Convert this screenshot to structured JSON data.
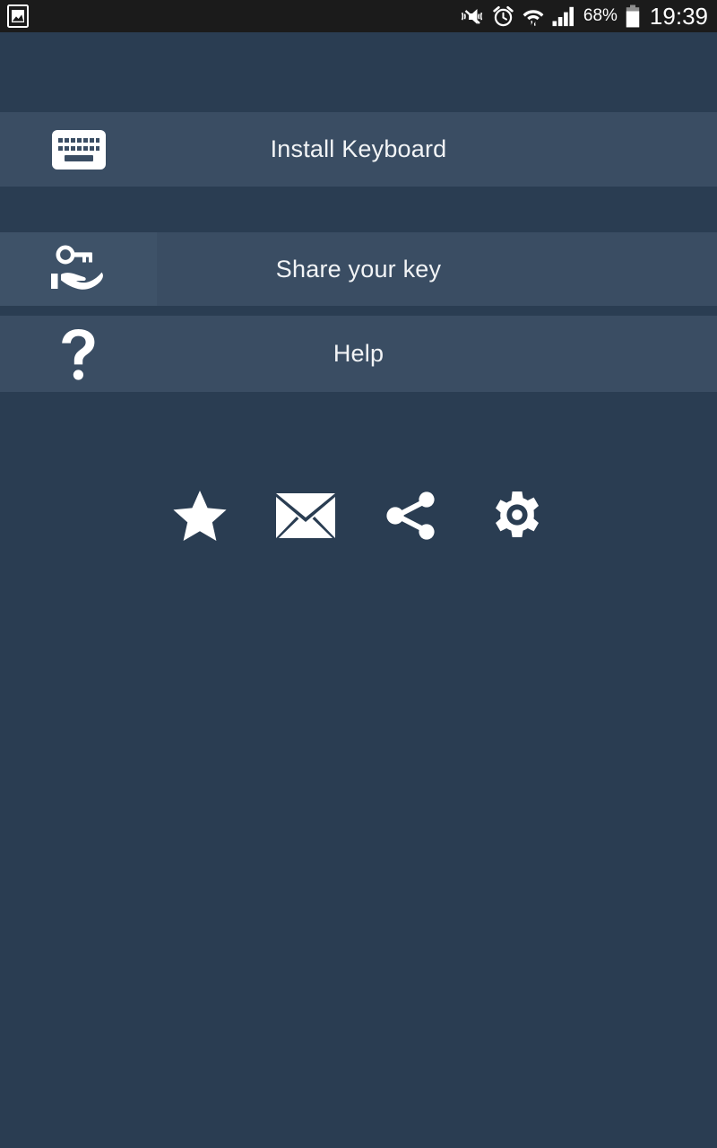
{
  "statusbar": {
    "left_icons": [
      {
        "name": "screenshot-image-icon",
        "glyph": "image"
      }
    ],
    "right_icons": [
      {
        "name": "vibrate-mute-icon",
        "glyph": "mute"
      },
      {
        "name": "alarm-clock-icon",
        "glyph": "alarm"
      },
      {
        "name": "wifi-data-icon",
        "glyph": "wifi"
      },
      {
        "name": "signal-bars-icon",
        "glyph": "signal"
      }
    ],
    "battery_percent": "68%",
    "battery_icon": "battery-icon",
    "clock": "19:39",
    "background": "#1b1b1b",
    "foreground": "#ffffff"
  },
  "theme": {
    "page_background": "#2a3d52",
    "row_background": "#3a4d63",
    "row_icon_tint": "#3e5268",
    "text_color": "#f2f4f6",
    "icon_color": "#ffffff"
  },
  "menu": {
    "rows": [
      {
        "id": "install-keyboard",
        "label": "Install Keyboard",
        "icon": "keyboard-icon",
        "tinted_icon_box": false
      },
      {
        "id": "share-your-key",
        "label": "Share your key",
        "icon": "hand-key-icon",
        "tinted_icon_box": true
      },
      {
        "id": "help",
        "label": "Help",
        "icon": "question-mark-icon",
        "tinted_icon_box": false
      }
    ]
  },
  "iconbar": {
    "buttons": [
      {
        "id": "rate",
        "icon": "star-icon"
      },
      {
        "id": "email",
        "icon": "envelope-icon"
      },
      {
        "id": "share",
        "icon": "share-icon"
      },
      {
        "id": "settings",
        "icon": "gear-icon"
      }
    ]
  }
}
